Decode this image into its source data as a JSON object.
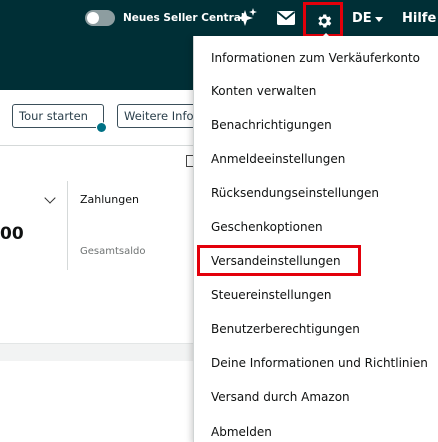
{
  "header": {
    "toggle_label": "Neues Seller Central",
    "language": "DE",
    "help": "Hilfe",
    "icons": [
      "sparkle-icon",
      "mail-icon",
      "gear-icon"
    ],
    "background": "#002f36",
    "highlight_color": "#e3000b"
  },
  "toolbar": {
    "tour_button": "Tour starten",
    "more_button": "Weitere Infos"
  },
  "cards": {
    "amount_fragment": "00",
    "payments_label": "Zahlungen",
    "balance_label": "Gesamtsaldo"
  },
  "settings_menu": {
    "items": [
      "Informationen zum Verkäuferkonto",
      "Konten verwalten",
      "Benachrichtigungen",
      "Anmeldeeinstellungen",
      "Rücksendungseinstellungen",
      "Geschenkoptionen",
      "Versandeinstellungen",
      "Steuereinstellungen",
      "Benutzerberechtigungen",
      "Deine Informationen und Richtlinien",
      "Versand durch Amazon",
      "Abmelden"
    ],
    "highlighted_item": "Versandeinstellungen"
  }
}
